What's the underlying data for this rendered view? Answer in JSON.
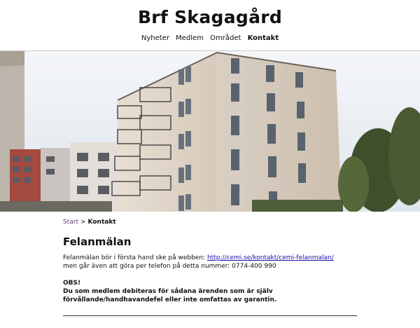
{
  "site": {
    "title": "Brf Skagagård"
  },
  "nav": {
    "items": [
      {
        "label": "Nyheter"
      },
      {
        "label": "Medlem"
      },
      {
        "label": "Området"
      },
      {
        "label": "Kontakt"
      }
    ]
  },
  "breadcrumb": {
    "home": "Start",
    "separator": ">",
    "current": "Kontakt"
  },
  "main": {
    "heading": "Felanmälan",
    "line1_prefix": "Felanmälan bör i första hand ske på webben: ",
    "link": "http://cemi.se/kontakt/cemi-felanmalan/",
    "line2": "men går även att göra per telefon på detta nummer: 0774-400 990",
    "obs_title": "OBS!",
    "obs_line1": "Du som medlem debiteras för sådana ärenden som är själv",
    "obs_line2": "förvållande/handhavandefel eller inte omfattas av garantin."
  }
}
